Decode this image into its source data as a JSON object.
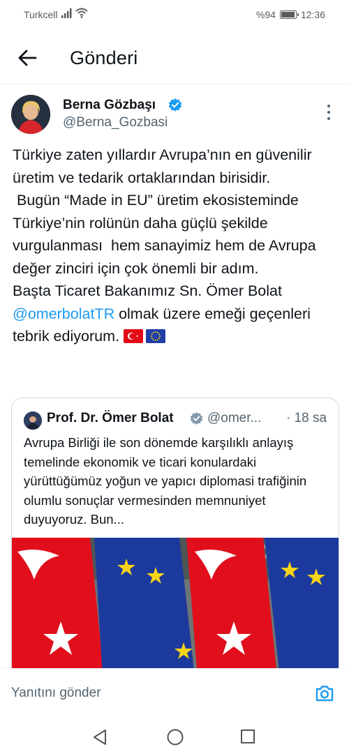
{
  "status_bar": {
    "carrier": "Turkcell",
    "battery": "%94",
    "battery_level": 0.94,
    "time": "12:36"
  },
  "header": {
    "title": "Gönderi"
  },
  "tweet": {
    "author_name": "Berna Gözbaşı",
    "author_handle": "@Berna_Gozbasi",
    "paragraph1": "Türkiye zaten yıllardır Avrupa’nın en güvenilir üretim ve tedarik ortaklarından birisidir.",
    "paragraph2": " Bugün “Made in EU” üretim ekosisteminde Türkiye’nin rolünün daha güçlü şekilde vurgulanması  hem sanayimiz hem de Avrupa değer zinciri için çok önemli bir adım.",
    "paragraph3_before": "Başta Ticaret Bakanımız Sn. Ömer Bolat ",
    "mention": "@omerbolatTR",
    "paragraph3_after": " olmak üzere emeği geçenleri tebrik ediyorum.",
    "flags": [
      "turkey-flag",
      "eu-flag"
    ]
  },
  "quoted_tweet": {
    "author_name": "Prof. Dr. Ömer Bolat",
    "author_handle": "@omer...",
    "time": "· 18 sa",
    "text": "Avrupa Birliği ile son dönemde karşılıklı anlayış temelinde ekonomik ve ticari konulardaki yürüttüğümüz yoğun ve yapıcı diplomasi trafiğinin olumlu sonuçlar vermesinden memnuniyet duyuyoruz. Bun..."
  },
  "reply": {
    "placeholder": "Yanıtını gönder"
  },
  "colors": {
    "accent": "#1d9bf0",
    "text": "#0f1419",
    "muted": "#536471",
    "flag_red": "#e30a17",
    "eu_blue": "#1f3ea8",
    "eu_gold": "#f7d417"
  },
  "icons": [
    "signal-icon",
    "wifi-icon",
    "battery-icon",
    "back-arrow-icon",
    "verified-icon",
    "more-vertical-icon",
    "camera-icon",
    "nav-back-icon",
    "nav-home-icon",
    "nav-recents-icon"
  ]
}
